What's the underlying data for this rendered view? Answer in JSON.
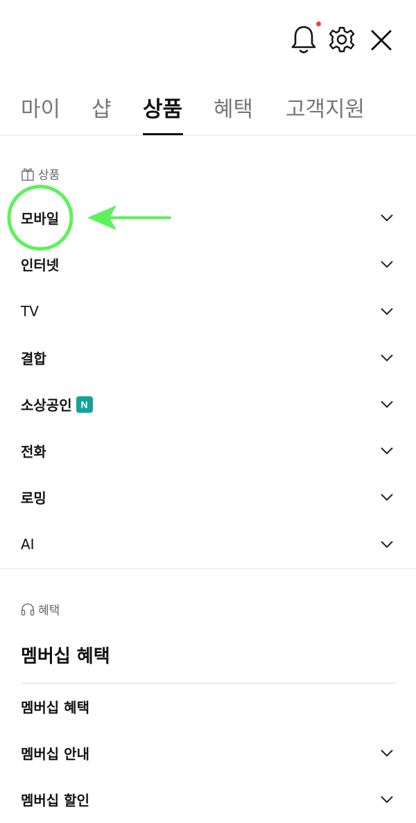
{
  "header": {
    "icons": [
      "bell-icon",
      "gear-icon",
      "close-icon"
    ],
    "notification_dot_color": "#e0464e"
  },
  "tabs": [
    {
      "label": "마이",
      "active": false
    },
    {
      "label": "샵",
      "active": false
    },
    {
      "label": "상품",
      "active": true
    },
    {
      "label": "혜택",
      "active": false
    },
    {
      "label": "고객지원",
      "active": false
    }
  ],
  "products": {
    "section_label": "상품",
    "section_icon": "gift-icon",
    "items": [
      {
        "label": "모바일",
        "chevron": true
      },
      {
        "label": "인터넷",
        "chevron": true
      },
      {
        "label": "TV",
        "chevron": true
      },
      {
        "label": "결합",
        "chevron": true
      },
      {
        "label": "소상공인",
        "badge": "N",
        "chevron": true
      },
      {
        "label": "전화",
        "chevron": true
      },
      {
        "label": "로밍",
        "chevron": true
      },
      {
        "label": "AI",
        "chevron": true
      }
    ]
  },
  "benefits": {
    "section_label": "혜택",
    "section_icon": "headphones-icon",
    "heading": "멤버십 혜택",
    "items": [
      {
        "label": "멤버십 혜택",
        "chevron": false
      },
      {
        "label": "멤버십 안내",
        "chevron": true
      },
      {
        "label": "멤버십 할인",
        "chevron": true
      }
    ]
  },
  "colors": {
    "badge_bg": "#12a39a",
    "annotation_green": "#5cf25c"
  }
}
